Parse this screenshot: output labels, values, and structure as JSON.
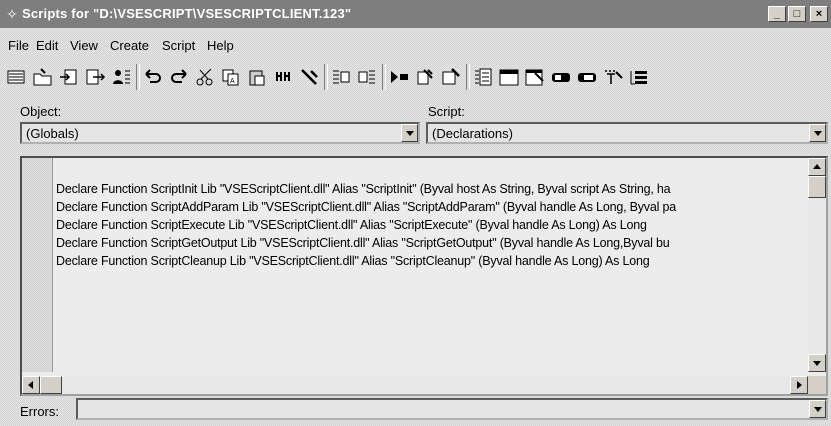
{
  "window": {
    "title": "Scripts for \"D:\\VSESCRIPT\\VSESCRIPTCLIENT.123\"",
    "controls": {
      "minimize": "_",
      "maximize": "□",
      "close": "×"
    }
  },
  "menu": [
    "File",
    "Edit",
    "View",
    "Create",
    "Script",
    "Help"
  ],
  "object": {
    "label": "Object:",
    "value": "(Globals)"
  },
  "script": {
    "label": "Script:",
    "value": "(Declarations)"
  },
  "code_lines": [
    "Declare Function ScriptInit Lib \"VSEScriptClient.dll\" Alias \"ScriptInit\" (Byval host As String, Byval script As String, ha",
    "Declare Function ScriptAddParam Lib \"VSEScriptClient.dll\" Alias \"ScriptAddParam\" (Byval handle As Long, Byval pa",
    "Declare Function ScriptExecute Lib \"VSEScriptClient.dll\" Alias \"ScriptExecute\" (Byval handle As Long) As Long",
    "Declare Function ScriptGetOutput Lib \"VSEScriptClient.dll\" Alias \"ScriptGetOutput\" (Byval handle As Long,Byval bu",
    "Declare Function ScriptCleanup Lib \"VSEScriptClient.dll\" Alias \"ScriptCleanup\" (Byval handle As Long) As Long"
  ],
  "errors": {
    "label": "Errors:",
    "value": ""
  },
  "toolbar_icons": [
    "new-script-icon",
    "open-icon",
    "import-icon",
    "export-icon",
    "properties-icon",
    "undo-icon",
    "redo-icon",
    "cut-icon",
    "copy-icon",
    "paste-icon",
    "find-icon",
    "help-icon",
    "indent-icon",
    "outdent-icon",
    "run-icon",
    "compile-icon",
    "debug-icon",
    "form-icon",
    "window-icon",
    "dialog-icon",
    "edit-box-icon",
    "button-icon",
    "help-topic-icon",
    "list-icon"
  ]
}
